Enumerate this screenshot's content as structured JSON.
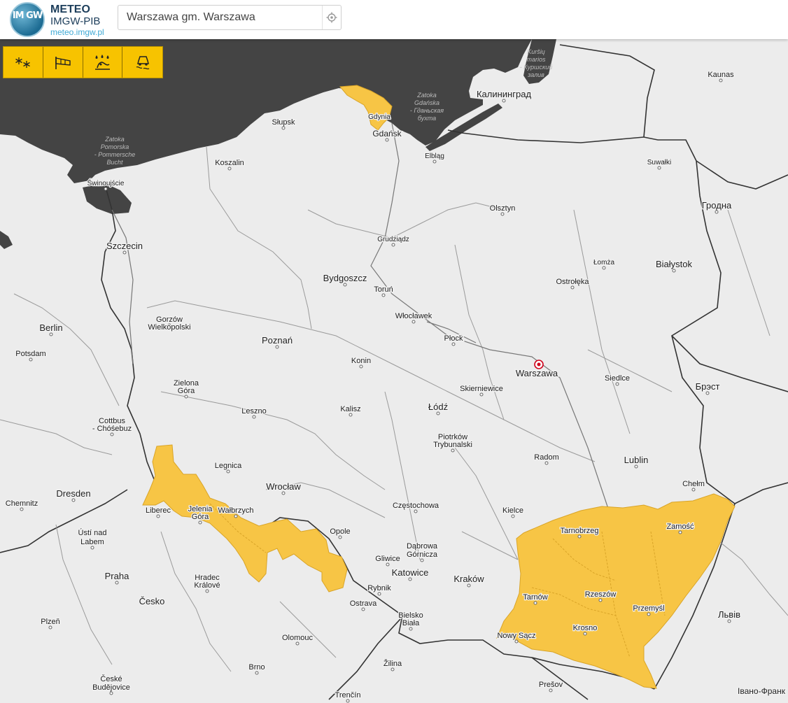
{
  "header": {
    "logo_letters": "IM GW",
    "brand_line1": "METEO",
    "brand_line2": "IMGW-PIB",
    "brand_line3": "meteo.imgw.pl",
    "search_value": "Warszawa gm. Warszawa",
    "locate_icon": "crosshair-icon"
  },
  "toolbar": {
    "buttons": [
      {
        "icon": "snowflakes-icon"
      },
      {
        "icon": "windsock-icon"
      },
      {
        "icon": "freezing-rain-icon"
      },
      {
        "icon": "slippery-road-icon"
      }
    ]
  },
  "colors": {
    "sea": "#444444",
    "land": "#ececec",
    "warning": "#f7c545",
    "toolbar": "#f7c300"
  },
  "sea_labels": {
    "zatoka_pomorska": [
      "Zatoka",
      "Pomorska",
      "- Pommersche",
      "Bucht"
    ],
    "zatoka_gdanska": [
      "Zatoka",
      "Gdańska",
      "- Гданьская",
      "бухта"
    ],
    "kursiu_marios": [
      "Kuršių",
      "marios",
      "- Куршский",
      "залив"
    ]
  },
  "cities": [
    {
      "name": "Kaliningrad_ru",
      "text": "Калининград"
    },
    {
      "name": "Kaunas",
      "text": "Kaunas"
    },
    {
      "name": "Slupsk",
      "text": "Słupsk"
    },
    {
      "name": "Gdynia",
      "text": "Gdynia"
    },
    {
      "name": "Gdansk",
      "text": "Gdańsk"
    },
    {
      "name": "Elblag",
      "text": "Elbląg"
    },
    {
      "name": "Suwalki",
      "text": "Suwałki"
    },
    {
      "name": "Koszalin",
      "text": "Koszalin"
    },
    {
      "name": "Swinoujscie",
      "text": "Świnoujście"
    },
    {
      "name": "Olsztyn",
      "text": "Olsztyn"
    },
    {
      "name": "Grodno",
      "text": "Гродна"
    },
    {
      "name": "Szczecin",
      "text": "Szczecin"
    },
    {
      "name": "Grudziadz",
      "text": "Grudziądz"
    },
    {
      "name": "Lomza",
      "text": "Łomża"
    },
    {
      "name": "Bialystok",
      "text": "Białystok"
    },
    {
      "name": "Bydgoszcz",
      "text": "Bydgoszcz"
    },
    {
      "name": "Torun",
      "text": "Toruń"
    },
    {
      "name": "Ostroleka",
      "text": "Ostrołęka"
    },
    {
      "name": "Wloclawek",
      "text": "Włocławek"
    },
    {
      "name": "Berlin",
      "text": "Berlin"
    },
    {
      "name": "Gorzow",
      "text": "Gorzów"
    },
    {
      "name": "Wielkopolski",
      "text": "Wielkopolski"
    },
    {
      "name": "Plock",
      "text": "Płock"
    },
    {
      "name": "Poznan",
      "text": "Poznań"
    },
    {
      "name": "Potsdam",
      "text": "Potsdam"
    },
    {
      "name": "Konin",
      "text": "Konin"
    },
    {
      "name": "Warszawa",
      "text": "Warszawa"
    },
    {
      "name": "Siedlce",
      "text": "Siedlce"
    },
    {
      "name": "Zielona",
      "text": "Zielona"
    },
    {
      "name": "Gora_z",
      "text": "Góra"
    },
    {
      "name": "Brest",
      "text": "Брэст"
    },
    {
      "name": "Skierniewice",
      "text": "Skierniewice"
    },
    {
      "name": "Lodz",
      "text": "Łódź"
    },
    {
      "name": "Leszno",
      "text": "Leszno"
    },
    {
      "name": "Kalisz",
      "text": "Kalisz"
    },
    {
      "name": "Cottbus",
      "text": "Cottbus"
    },
    {
      "name": "Chosebuz",
      "text": "- Chóśebuz"
    },
    {
      "name": "Piotrkow",
      "text": "Piotrków"
    },
    {
      "name": "Trybunalski",
      "text": "Trybunalski"
    },
    {
      "name": "Radom",
      "text": "Radom"
    },
    {
      "name": "Lublin",
      "text": "Lublin"
    },
    {
      "name": "Legnica",
      "text": "Legnica"
    },
    {
      "name": "Wroclaw",
      "text": "Wrocław"
    },
    {
      "name": "Chelm",
      "text": "Chełm"
    },
    {
      "name": "Chemnitz",
      "text": "Chemnitz"
    },
    {
      "name": "Dresden",
      "text": "Dresden"
    },
    {
      "name": "Liberec",
      "text": "Liberec"
    },
    {
      "name": "Jelenia",
      "text": "Jelenia"
    },
    {
      "name": "Gora_j",
      "text": "Góra"
    },
    {
      "name": "Walbrzych",
      "text": "Wałbrzych"
    },
    {
      "name": "Czestochowa",
      "text": "Częstochowa"
    },
    {
      "name": "Kielce",
      "text": "Kielce"
    },
    {
      "name": "Zamosc",
      "text": "Zamość"
    },
    {
      "name": "Usti",
      "text": "Ústí nad"
    },
    {
      "name": "Labem",
      "text": "Labem"
    },
    {
      "name": "Opole",
      "text": "Opole"
    },
    {
      "name": "Tarnobrzeg",
      "text": "Tarnobrzeg"
    },
    {
      "name": "Dabrowa",
      "text": "Dąbrowa"
    },
    {
      "name": "Gornicza",
      "text": "Górnicza"
    },
    {
      "name": "Gliwice",
      "text": "Gliwice"
    },
    {
      "name": "Katowice",
      "text": "Katowice"
    },
    {
      "name": "Krakow",
      "text": "Kraków"
    },
    {
      "name": "Praha",
      "text": "Praha"
    },
    {
      "name": "Hradec",
      "text": "Hradec"
    },
    {
      "name": "Kralove",
      "text": "Králové"
    },
    {
      "name": "Rybnik",
      "text": "Rybnik"
    },
    {
      "name": "Rzeszow",
      "text": "Rzeszów"
    },
    {
      "name": "Tarnow",
      "text": "Tarnów"
    },
    {
      "name": "Cesko",
      "text": "Česko"
    },
    {
      "name": "Ostrava",
      "text": "Ostrava"
    },
    {
      "name": "Przemysl",
      "text": "Przemyśl"
    },
    {
      "name": "Bielsko",
      "text": "Bielsko"
    },
    {
      "name": "Biala",
      "text": "Biała"
    },
    {
      "name": "Lviv",
      "text": "Львів"
    },
    {
      "name": "Plzen",
      "text": "Plzeň"
    },
    {
      "name": "Krosno",
      "text": "Krosno"
    },
    {
      "name": "Nowy_Sacz",
      "text": "Nowy Sącz"
    },
    {
      "name": "Olomouc",
      "text": "Olomouc"
    },
    {
      "name": "Zilina",
      "text": "Žilina"
    },
    {
      "name": "Brno",
      "text": "Brno"
    },
    {
      "name": "Ceske",
      "text": "České"
    },
    {
      "name": "Budejovice",
      "text": "Budějovice"
    },
    {
      "name": "Presov",
      "text": "Prešov"
    },
    {
      "name": "Ivano",
      "text": "Івано-Франк"
    },
    {
      "name": "Trencin",
      "text": "Trenčín"
    }
  ]
}
